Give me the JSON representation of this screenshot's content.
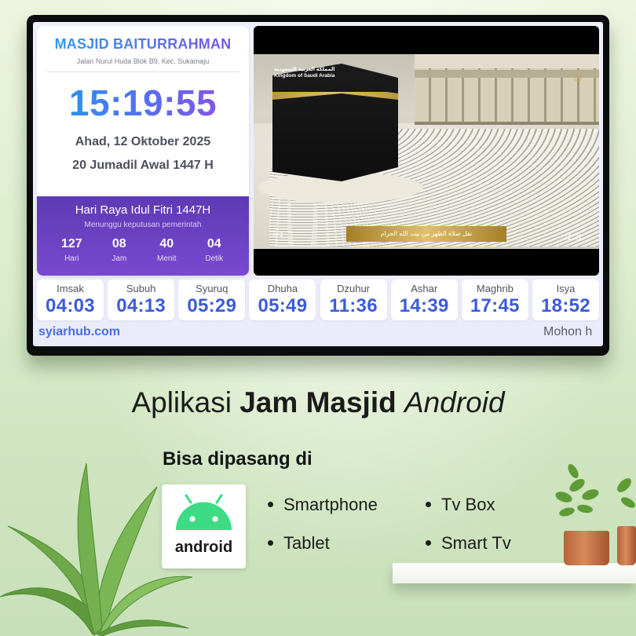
{
  "display": {
    "mosque_name": "MASJID BAITURRAHMAN",
    "address": "Jalan Nurul Huda Blok B9, Kec. Sukamaju",
    "clock": "15:19:55",
    "date_gregorian": "Ahad, 12 Oktober 2025",
    "date_hijri": "20 Jumadil Awal 1447 H",
    "event": {
      "title": "Hari Raya Idul Fitri 1447H",
      "subtitle": "Menunggu keputusan pemerintah",
      "countdown": [
        {
          "value": "127",
          "label": "Hari"
        },
        {
          "value": "08",
          "label": "Jam"
        },
        {
          "value": "40",
          "label": "Menit"
        },
        {
          "value": "04",
          "label": "Detik"
        }
      ]
    },
    "video": {
      "channel_label_ar": "المملكة العربية السعودية",
      "channel_label_en": "Kingdom of Saudi Arabia",
      "ticker": "نقل صلاة الظهر من بيت الله الحرام",
      "time": "12:21",
      "temp": "36°C"
    },
    "prayer_times": [
      {
        "name": "Imsak",
        "time": "04:03"
      },
      {
        "name": "Subuh",
        "time": "04:13"
      },
      {
        "name": "Syuruq",
        "time": "05:29"
      },
      {
        "name": "Dhuha",
        "time": "05:49"
      },
      {
        "name": "Dzuhur",
        "time": "11:36"
      },
      {
        "name": "Ashar",
        "time": "14:39"
      },
      {
        "name": "Maghrib",
        "time": "17:45"
      },
      {
        "name": "Isya",
        "time": "18:52"
      }
    ],
    "footer_site": "syiarhub.com",
    "footer_ticker": "Mohon h"
  },
  "promo": {
    "headline_normal": "Aplikasi ",
    "headline_bold": "Jam Masjid",
    "headline_italic": "Android",
    "subhead": "Bisa dipasang di",
    "android_word": "android",
    "features_col1": [
      "Smartphone",
      "Tablet"
    ],
    "features_col2": [
      "Tv Box",
      "Smart Tv"
    ]
  },
  "colors": {
    "android_green": "#3ddc84",
    "event_purple": "#6a42c4",
    "time_blue": "#3c5bd8"
  }
}
